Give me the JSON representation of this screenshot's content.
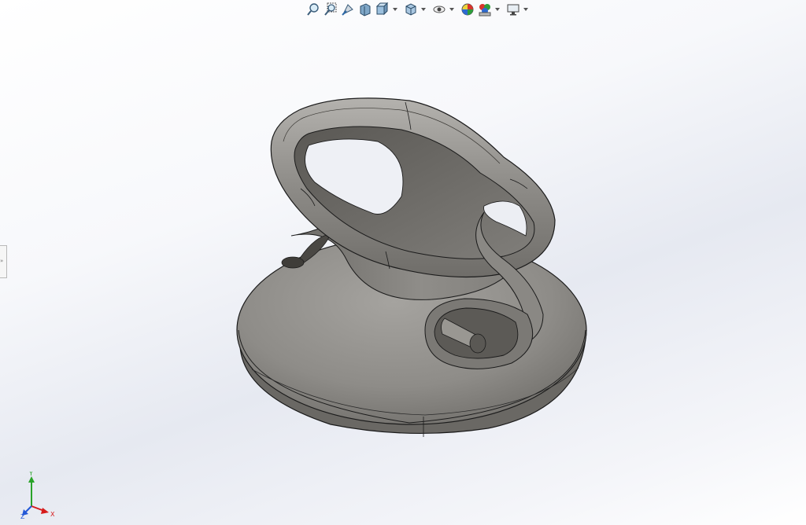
{
  "toolbar": {
    "buttons": [
      {
        "name": "zoom-to-fit-icon"
      },
      {
        "name": "zoom-to-area-icon"
      },
      {
        "name": "previous-view-icon"
      },
      {
        "name": "section-view-icon"
      },
      {
        "name": "view-orientation-icon",
        "dropdown": true
      },
      {
        "name": "display-style-icon",
        "dropdown": true
      },
      {
        "name": "hide-show-items-icon",
        "dropdown": true
      },
      {
        "name": "edit-appearance-icon"
      },
      {
        "name": "apply-scene-icon",
        "dropdown": true
      },
      {
        "name": "view-settings-icon",
        "dropdown": true
      }
    ]
  },
  "triad": {
    "x_label": "X",
    "y_label": "Y",
    "z_label": "Z",
    "colors": {
      "x": "#d61b1b",
      "y": "#29a329",
      "z": "#2458d6"
    }
  },
  "model": {
    "body_color": "#8c8a85",
    "edge_color": "#1b1b1b"
  }
}
